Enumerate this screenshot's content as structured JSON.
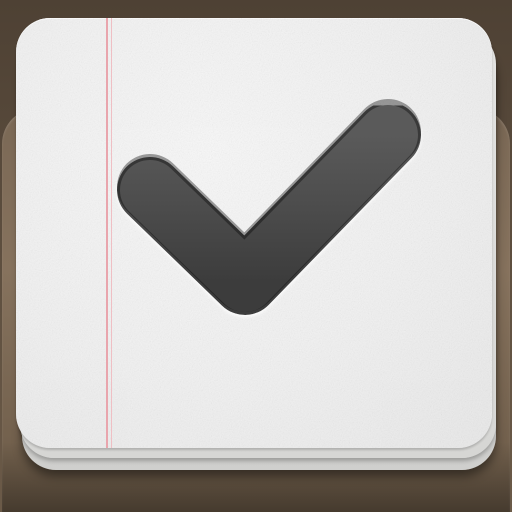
{
  "app_icon": {
    "icon_name": "checkmark-icon",
    "colors": {
      "background_frame": "#5a4a3a",
      "paper": "#f2f2f2",
      "margin_line": "#e9a5ad",
      "checkmark": "#4a4a4a"
    }
  }
}
